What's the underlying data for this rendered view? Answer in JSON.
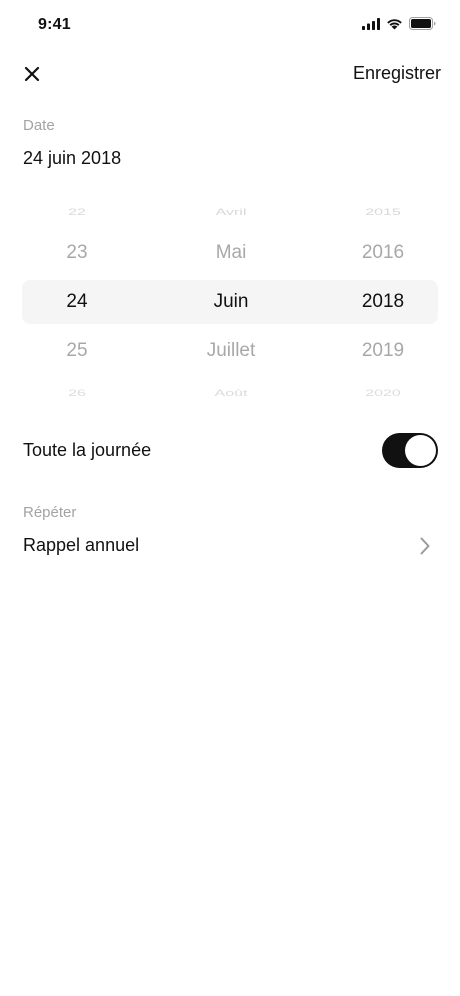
{
  "status_bar": {
    "time": "9:41",
    "icons": [
      "signal-icon",
      "wifi-icon",
      "battery-icon"
    ]
  },
  "nav": {
    "close_icon": "close-icon",
    "save_label": "Enregistrer"
  },
  "date_section": {
    "label": "Date",
    "value": "24 juin 2018"
  },
  "picker": {
    "days": [
      "22",
      "23",
      "24",
      "25",
      "26"
    ],
    "months": [
      "Avril",
      "Mai",
      "Juin",
      "Juillet",
      "Août"
    ],
    "years": [
      "2015",
      "2016",
      "2018",
      "2019",
      "2020"
    ],
    "selected": {
      "day": "24",
      "month": "Juin",
      "year": "2018"
    }
  },
  "all_day": {
    "label": "Toute la journée",
    "enabled": true
  },
  "repeat": {
    "label": "Répéter",
    "value": "Rappel annuel",
    "chevron_icon": "chevron-right-icon"
  },
  "colors": {
    "text": "#111111",
    "secondary": "#a3a3a3",
    "toggle_on": "#111111",
    "highlight": "#f5f5f5"
  }
}
